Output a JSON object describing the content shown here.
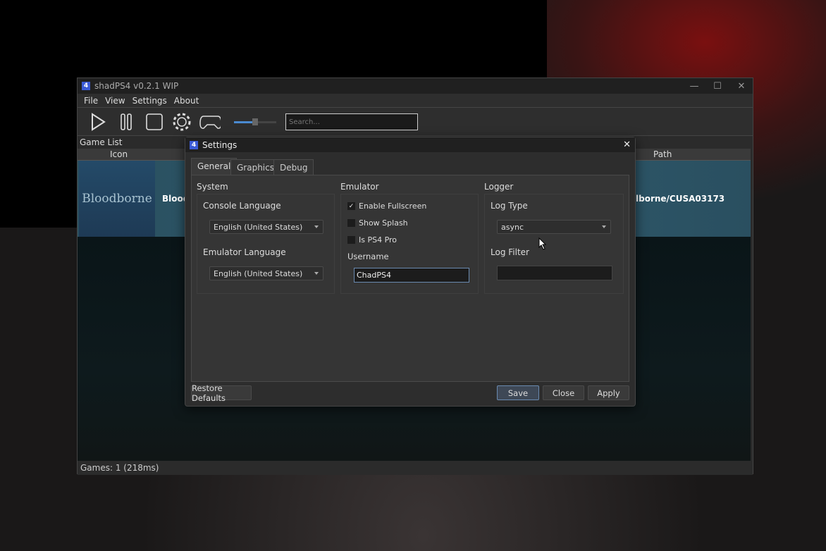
{
  "window": {
    "title": "shadPS4 v0.2.1 WIP",
    "app_icon": "4",
    "minimize": "—",
    "maximize": "☐",
    "close": "✕"
  },
  "menu": [
    "File",
    "View",
    "Settings",
    "About"
  ],
  "toolbar": {
    "icons": [
      "play-icon",
      "pause-icon",
      "stop-icon",
      "gear-icon",
      "gamepad-icon"
    ],
    "volume_slider": 0.5,
    "search_placeholder": "Search..."
  },
  "game_list": {
    "title": "Game List",
    "columns": {
      "icon": "Icon",
      "path": "Path"
    },
    "rows": [
      {
        "cover_text": "Bloodborne",
        "name": "Bloodl",
        "path": "lborne/CUSA03173"
      }
    ]
  },
  "status": "Games: 1 (218ms)",
  "settings": {
    "title": "Settings",
    "close": "✕",
    "tabs": [
      "General",
      "Graphics",
      "Debug"
    ],
    "system": {
      "title": "System",
      "console_language_label": "Console Language",
      "console_language": "English (United States)",
      "emulator_language_label": "Emulator Language",
      "emulator_language": "English (United States)"
    },
    "emulator": {
      "title": "Emulator",
      "enable_fullscreen": "Enable Fullscreen",
      "enable_fullscreen_checked": true,
      "show_splash": "Show Splash",
      "show_splash_checked": false,
      "is_ps4_pro": "Is PS4 Pro",
      "is_ps4_pro_checked": false,
      "username_label": "Username",
      "username": "ChadPS4"
    },
    "logger": {
      "title": "Logger",
      "log_type_label": "Log Type",
      "log_type": "async",
      "log_filter_label": "Log Filter",
      "log_filter": ""
    },
    "buttons": {
      "restore": "Restore Defaults",
      "save": "Save",
      "close": "Close",
      "apply": "Apply"
    }
  },
  "colors": {
    "accent": "#3b5bd6",
    "save_border": "#6a8ab0"
  }
}
